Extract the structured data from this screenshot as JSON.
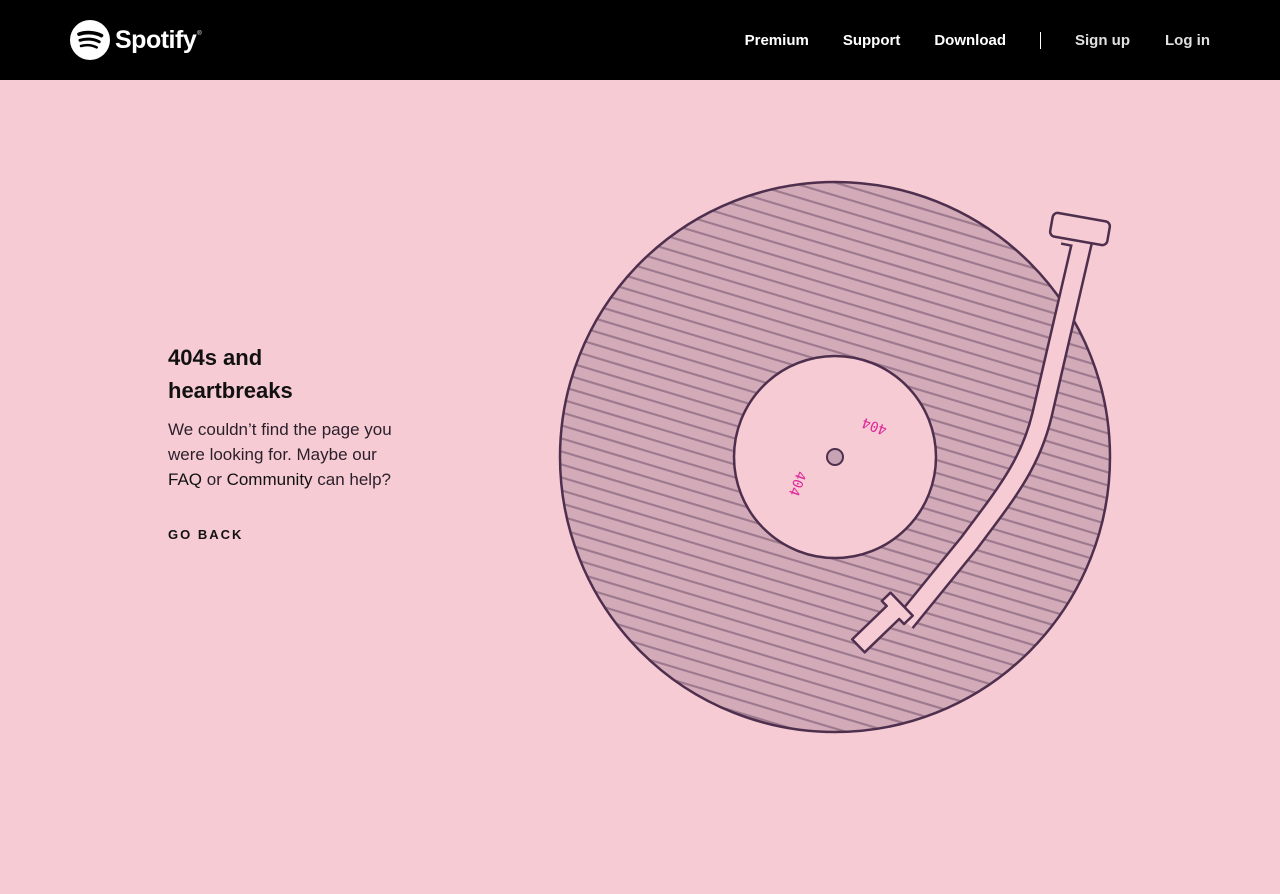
{
  "header": {
    "logo_text": "Spotify",
    "logo_trademark": "®",
    "nav_primary": [
      "Premium",
      "Support",
      "Download"
    ],
    "nav_secondary": [
      "Sign up",
      "Log in"
    ]
  },
  "main": {
    "heading": "404s and heartbreaks",
    "message_before": "We couldn’t find the page you were looking for. Maybe our ",
    "faq_link": "FAQ",
    "message_middle": " or ",
    "community_link": "Community",
    "message_after": " can help?",
    "go_back": "GO BACK"
  },
  "record": {
    "label_text_1": "404",
    "label_text_2": "404"
  },
  "colors": {
    "background": "#f6cbd3",
    "topbar": "#000000",
    "record_fill": "#d3aab7",
    "record_outline": "#4e2f4d",
    "label_accent": "#e0289a"
  }
}
